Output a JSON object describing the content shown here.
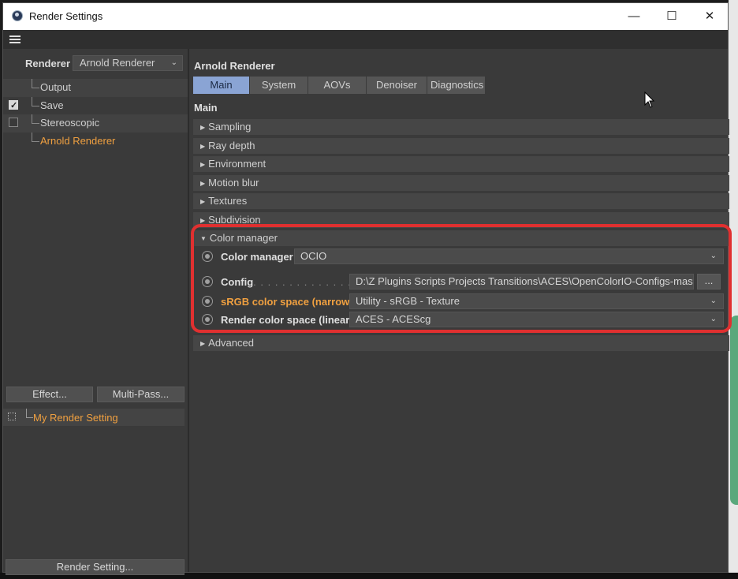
{
  "window": {
    "title": "Render Settings",
    "controls": {
      "minimize": "—",
      "maximize": "☐",
      "close": "✕"
    }
  },
  "left": {
    "renderer_label": "Renderer",
    "renderer_value": "Arnold Renderer",
    "tree": [
      {
        "label": "Output",
        "checkbox": "none",
        "active": false
      },
      {
        "label": "Save",
        "checkbox": "checked",
        "active": false
      },
      {
        "label": "Stereoscopic",
        "checkbox": "unchecked",
        "active": false
      },
      {
        "label": "Arnold Renderer",
        "checkbox": "none",
        "active": true
      }
    ],
    "effect_button": "Effect...",
    "multipass_button": "Multi-Pass...",
    "render_setting_name": "My Render Setting",
    "render_setting_button": "Render Setting..."
  },
  "right": {
    "panel_title": "Arnold Renderer",
    "tabs": [
      "Main",
      "System",
      "AOVs",
      "Denoiser",
      "Diagnostics"
    ],
    "active_tab": "Main",
    "section_title": "Main",
    "groups": {
      "sampling": "Sampling",
      "ray_depth": "Ray depth",
      "environment": "Environment",
      "motion_blur": "Motion blur",
      "textures": "Textures",
      "subdivision": "Subdivision",
      "color_manager": "Color manager",
      "advanced": "Advanced"
    },
    "color_manager": {
      "manager_label": "Color manager",
      "manager_value": "OCIO",
      "config_label": "Config",
      "config_dots": ". . . . . . . . . . . . . . . .",
      "config_value": "D:\\Z Plugins Scripts Projects Transitions\\ACES\\OpenColorIO-Configs-master",
      "browse_label": "...",
      "srgb_label": "sRGB color space (narrow)",
      "srgb_value": "Utility - sRGB - Texture",
      "render_label": "Render color space (linear)",
      "render_value": "ACES - ACEScg"
    }
  },
  "colors": {
    "accent_orange": "#f0a040",
    "tab_active": "#8aa4d4",
    "highlight_red": "#e03030",
    "panel_bg": "#3a3a3a"
  }
}
